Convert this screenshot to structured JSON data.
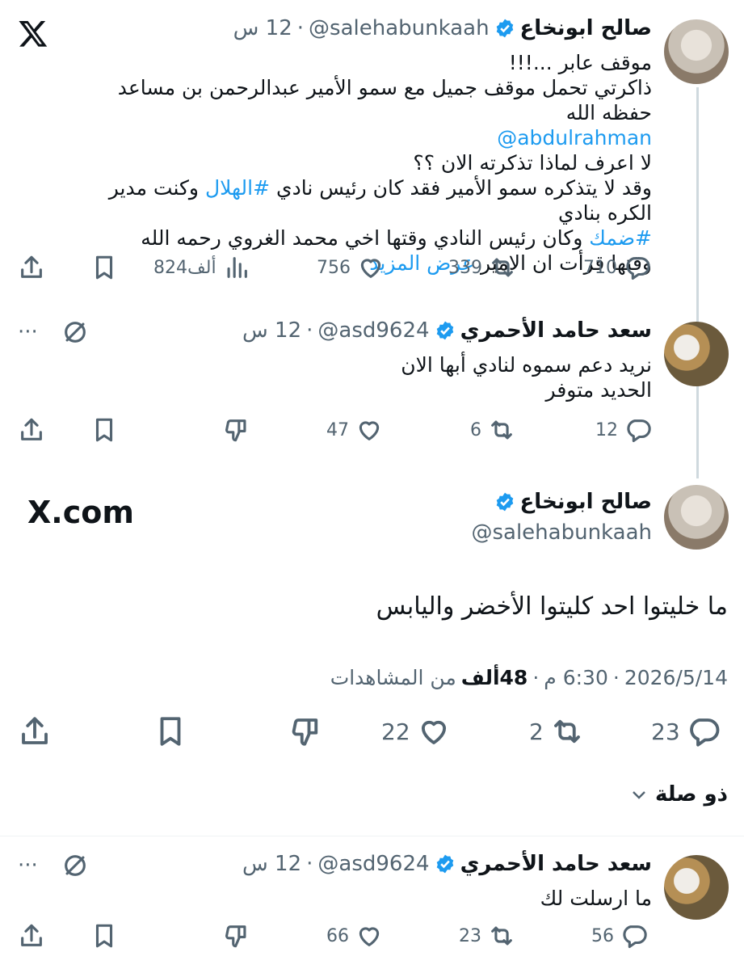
{
  "top_logo": "X",
  "tweet1": {
    "name": "صالح ابونخاع",
    "handle": "@salehabunkaah",
    "time": "12 س",
    "sep": "·",
    "lines": [
      {
        "text": "موقف عابر ...!!!"
      },
      {
        "text": "ذاكرتي تحمل موقف  جميل مع سمو الأمير عبدالرحمن بن مساعد حفظه الله"
      },
      {
        "text": "@abdulrahman"
      },
      {
        "text": "لا اعرف لماذا تذكرته الان ؟؟"
      },
      {
        "pre": "وقد لا يتذكره سمو الأمير فقد كان رئيس نادي ",
        "tag": "#الهلال",
        "post": " وكنت مدير الكره بنادي"
      },
      {
        "tag": "#ضمك",
        "post": " وكان رئيس النادي وقتها اخي محمد الغروي رحمه الله"
      },
      {
        "pre": "وقتها قرأت ان الامير ",
        "more": "عرض المزيد"
      }
    ],
    "replies": "710",
    "reposts": "339",
    "likes": "756",
    "views": "824ألف"
  },
  "tweet2": {
    "name": "سعد حامد الأحمري",
    "handle": "@asd9624",
    "time": "12 س",
    "sep": "·",
    "more": "···",
    "lines": [
      "نريد دعم سموه لنادي أبها الان",
      "الحديد متوفر"
    ],
    "replies": "12",
    "reposts": "6",
    "likes": "47"
  },
  "main": {
    "brand": "X.com",
    "name": "صالح ابونخاع",
    "handle": "@salehabunkaah",
    "text": "ما خليتوا احد كليتوا الأخضر واليابس",
    "date": "2026/5/14",
    "time": "6:30 م",
    "views_count": "48ألف",
    "views_label": "من المشاهدات",
    "sep": "·",
    "replies": "23",
    "reposts": "2",
    "likes": "22"
  },
  "related": {
    "label": "ذو صلة"
  },
  "tweet3": {
    "name": "سعد حامد الأحمري",
    "handle": "@asd9624",
    "time": "12 س",
    "sep": "·",
    "more": "···",
    "text": "ما ارسلت لك",
    "replies": "56",
    "reposts": "23",
    "likes": "66"
  },
  "colors": {
    "accent": "#1d9bf0",
    "text": "#0f1419",
    "muted": "#536471",
    "line": "#cfd9de"
  }
}
